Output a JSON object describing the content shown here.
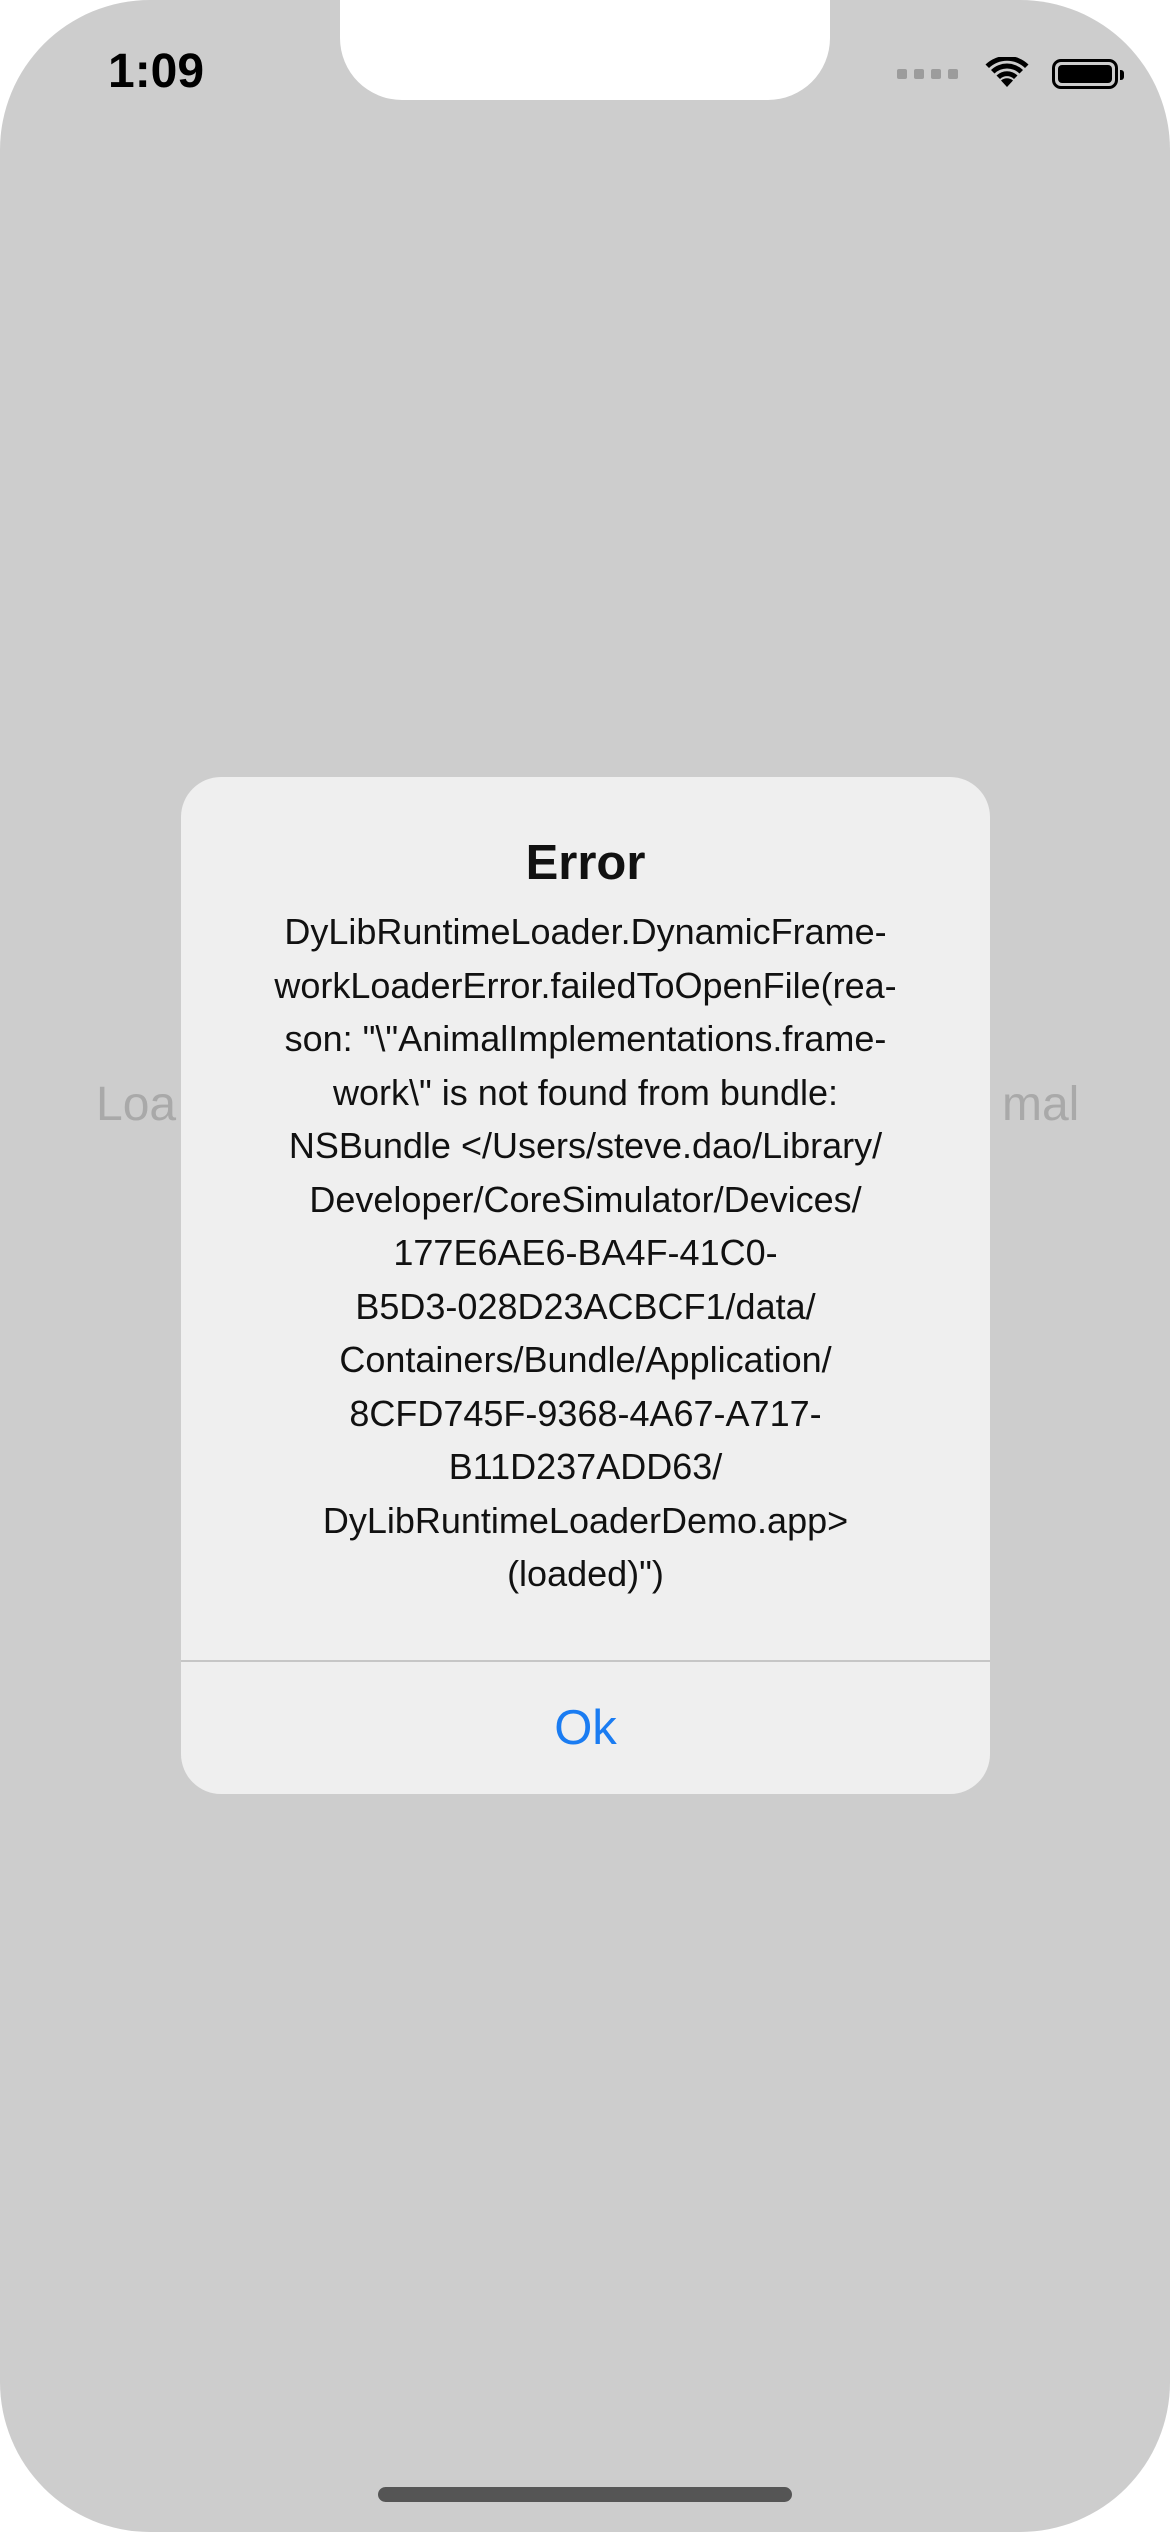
{
  "status_bar": {
    "time": "1:09"
  },
  "background": {
    "button_text_left": "Loa",
    "button_text_right": "mal"
  },
  "alert": {
    "title": "Error",
    "message": "DyLibRuntimeLoader.DynamicFrame-\nworkLoaderError.failedToOpenFile(rea-\nson: \"\\\"AnimalImplementations.frame-\nwork\\\" is not found from bundle:\nNSBundle </Users/steve.dao/Library/\nDeveloper/CoreSimulator/Devices/\n177E6AE6-BA4F-41C0-\nB5D3-028D23ACBCF1/data/\nContainers/Bundle/Application/\n8CFD745F-9368-4A67-A717-\nB11D237ADD63/\nDyLibRuntimeLoaderDemo.app>\n(loaded)\")",
    "ok_label": "Ok"
  },
  "colors": {
    "accent": "#1a7cf2",
    "dim_background": "#cdcdcd",
    "alert_background": "#efefef"
  }
}
